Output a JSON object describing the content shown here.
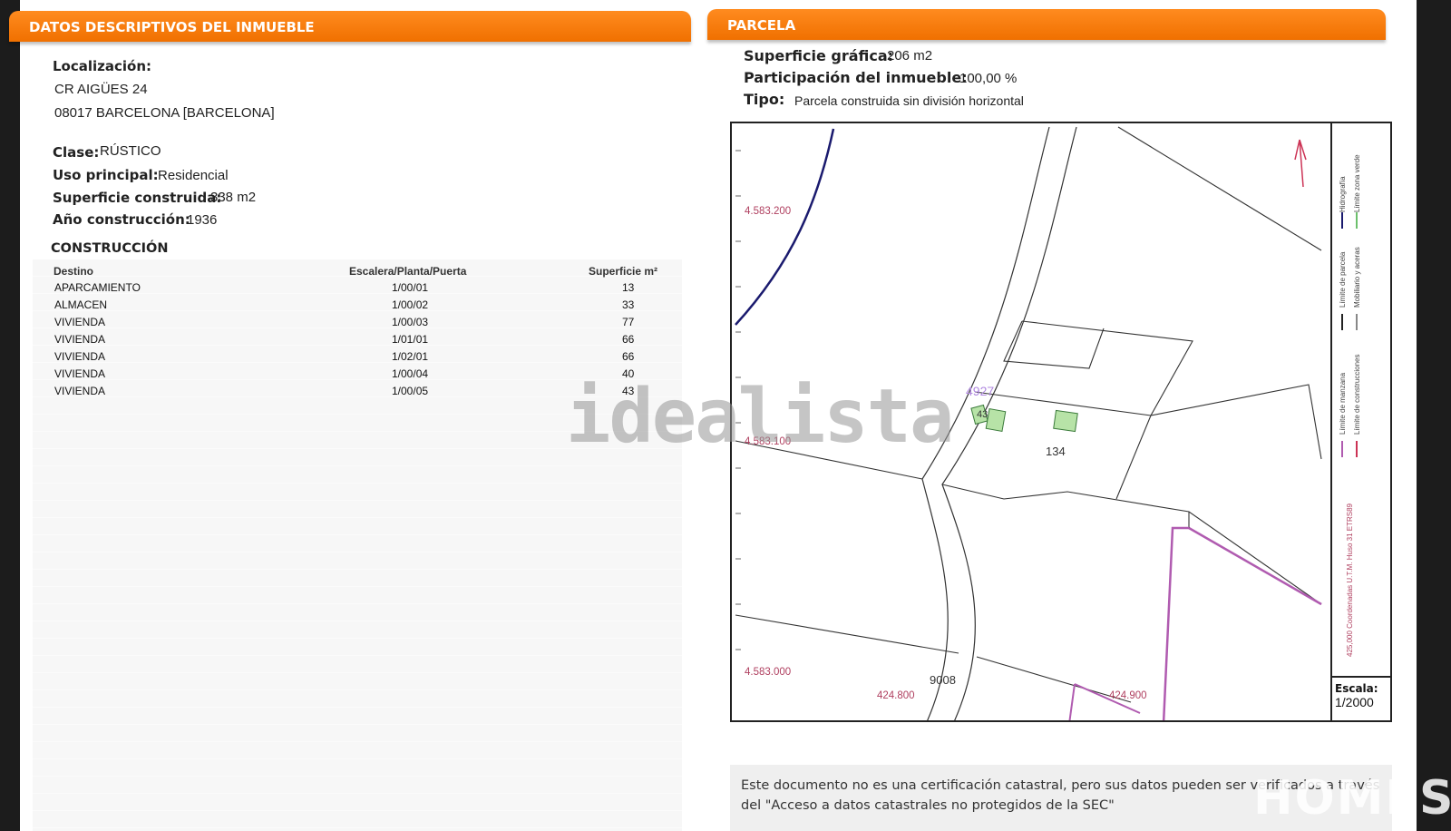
{
  "left": {
    "header": "DATOS DESCRIPTIVOS DEL INMUEBLE",
    "localizacion_label": "Localización:",
    "address_line1": "CR AIGÜES 24",
    "address_line2": "08017 BARCELONA [BARCELONA]",
    "clase_label": "Clase:",
    "clase_value": "RÚSTICO",
    "uso_label": "Uso principal:",
    "uso_value": "Residencial",
    "superficie_label": "Superficie construida:",
    "superficie_value": "338 m2",
    "anio_label": "Año construcción:",
    "anio_value": "1936",
    "construccion_title": "CONSTRUCCIÓN",
    "table": {
      "headers": [
        "Destino",
        "Escalera/Planta/Puerta",
        "Superficie m²"
      ],
      "rows": [
        [
          "APARCAMIENTO",
          "1/00/01",
          "13"
        ],
        [
          "ALMACEN",
          "1/00/02",
          "33"
        ],
        [
          "VIVIENDA",
          "1/00/03",
          "77"
        ],
        [
          "VIVIENDA",
          "1/01/01",
          "66"
        ],
        [
          "VIVIENDA",
          "1/02/01",
          "66"
        ],
        [
          "VIVIENDA",
          "1/00/04",
          "40"
        ],
        [
          "VIVIENDA",
          "1/00/05",
          "43"
        ]
      ]
    }
  },
  "right": {
    "header": "PARCELA",
    "superficie_grafica_label": "Superficie gráfica:",
    "superficie_grafica_value": "206 m2",
    "participacion_label": "Participación del inmueble:",
    "participacion_value": "100,00 %",
    "tipo_label": "Tipo:",
    "tipo_value": "Parcela construida sin división horizontal",
    "map": {
      "y_labels": [
        "4.583.200",
        "4.583.100",
        "4.583.000"
      ],
      "x_labels": [
        "424.800",
        "424.900"
      ],
      "parcel_labels": [
        "4927",
        "134",
        "9008",
        "43"
      ],
      "legend": [
        "Hidrografía",
        "Límite zona verde",
        "Límite de parcela",
        "Mobiliario y aceras",
        "Límite de manzana",
        "Límite de construcciones",
        "425,000 Coordenadas U.T.M. Huso 31 ETRS89"
      ],
      "scale_label": "Escala:",
      "scale_value": "1/2000"
    },
    "note": "Este documento no es una certificación catastral, pero sus datos pueden ser verificados a través del \"Acceso a datos catastrales no protegidos de la SEC\""
  },
  "watermarks": {
    "idealista": "idealista",
    "homes": "HOMES"
  }
}
